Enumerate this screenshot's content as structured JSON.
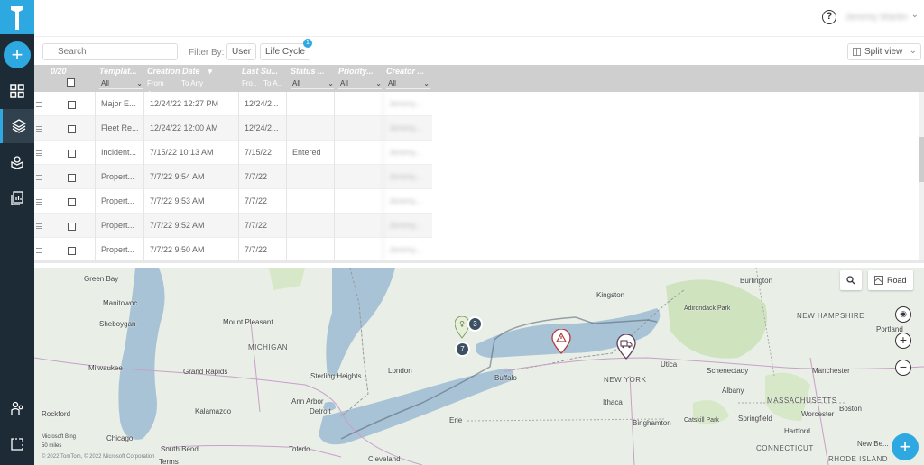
{
  "app": {
    "user_name": "Jeremy Martin"
  },
  "toolbar": {
    "search_placeholder": "Search",
    "filter_label": "Filter By:",
    "filter_user": "User",
    "filter_lifecycle": "Life Cycle",
    "lifecycle_badge": "1",
    "split_view": "Split view"
  },
  "table": {
    "count": "0/20",
    "columns": [
      "Templat...",
      "Creation Date",
      "Last Su...",
      "Status ...",
      "Priority...",
      "Creator ..."
    ],
    "filters": {
      "template": "All",
      "date_from": "From Any",
      "date_to": "To Any",
      "last_from": "Fro..",
      "last_to": "To A..",
      "status": "All",
      "priority": "All",
      "creator": "All"
    },
    "rows": [
      {
        "template": "Major E...",
        "created": "12/24/22 12:27 PM",
        "last": "12/24/2...",
        "status": "",
        "creator": "Jeremy..."
      },
      {
        "template": "Fleet Re...",
        "created": "12/24/22 12:00 AM",
        "last": "12/24/2...",
        "status": "",
        "creator": "Jeremy..."
      },
      {
        "template": "Incident...",
        "created": "7/15/22 10:13 AM",
        "last": "7/15/22",
        "status": "Entered",
        "creator": "Jeremy..."
      },
      {
        "template": "Propert...",
        "created": "7/7/22 9:54 AM",
        "last": "7/7/22",
        "status": "",
        "creator": "Jeremy..."
      },
      {
        "template": "Propert...",
        "created": "7/7/22 9:53 AM",
        "last": "7/7/22",
        "status": "",
        "creator": "Jeremy..."
      },
      {
        "template": "Propert...",
        "created": "7/7/22 9:52 AM",
        "last": "7/7/22",
        "status": "",
        "creator": "Jeremy..."
      },
      {
        "template": "Propert...",
        "created": "7/7/22 9:50 AM",
        "last": "7/7/22",
        "status": "",
        "creator": "Jeremy..."
      }
    ]
  },
  "map": {
    "road_label": "Road",
    "cluster_1": "3",
    "cluster_2": "7",
    "labels": {
      "green_bay": "Green Bay",
      "manitowoc": "Manitowoc",
      "sheboygan": "Sheboygan",
      "mount_pleasant": "Mount Pleasant",
      "michigan": "MICHIGAN",
      "milwaukee": "Milwaukee",
      "grand_rapids": "Grand Rapids",
      "sterling_heights": "Sterling Heights",
      "london": "London",
      "ann_arbor": "Ann Arbor",
      "detroit": "Detroit",
      "kalamazoo": "Kalamazoo",
      "rockford": "Rockford",
      "chicago": "Chicago",
      "south_bend": "South Bend",
      "terms": "Terms",
      "toledo": "Toledo",
      "cleveland": "Cleveland",
      "erie": "Erie",
      "buffalo": "Buffalo",
      "kingston": "Kingston",
      "burlington": "Burlington",
      "adirondack": "Adirondack Park",
      "new_hampshire": "NEW HAMPSHIRE",
      "portland": "Portland",
      "utica": "Utica",
      "schenectady": "Schenectady",
      "manchester": "Manchester",
      "new_york": "NEW YORK",
      "albany": "Albany",
      "ithaca": "Ithaca",
      "massachusetts": "MASSACHUSETTS",
      "catskill": "Catskill Park",
      "springfield": "Springfield",
      "worcester": "Worcester",
      "boston": "Boston",
      "binghamton": "Binghamton",
      "hartford": "Hartford",
      "connecticut": "CONNECTICUT",
      "new_bedford": "New Be...",
      "rhode_island": "RHODE ISLAND",
      "copyright": "© 2022 TomTom, © 2022 Microsoft Corporation",
      "scale": "50 miles",
      "bing": "Microsoft Bing"
    }
  }
}
